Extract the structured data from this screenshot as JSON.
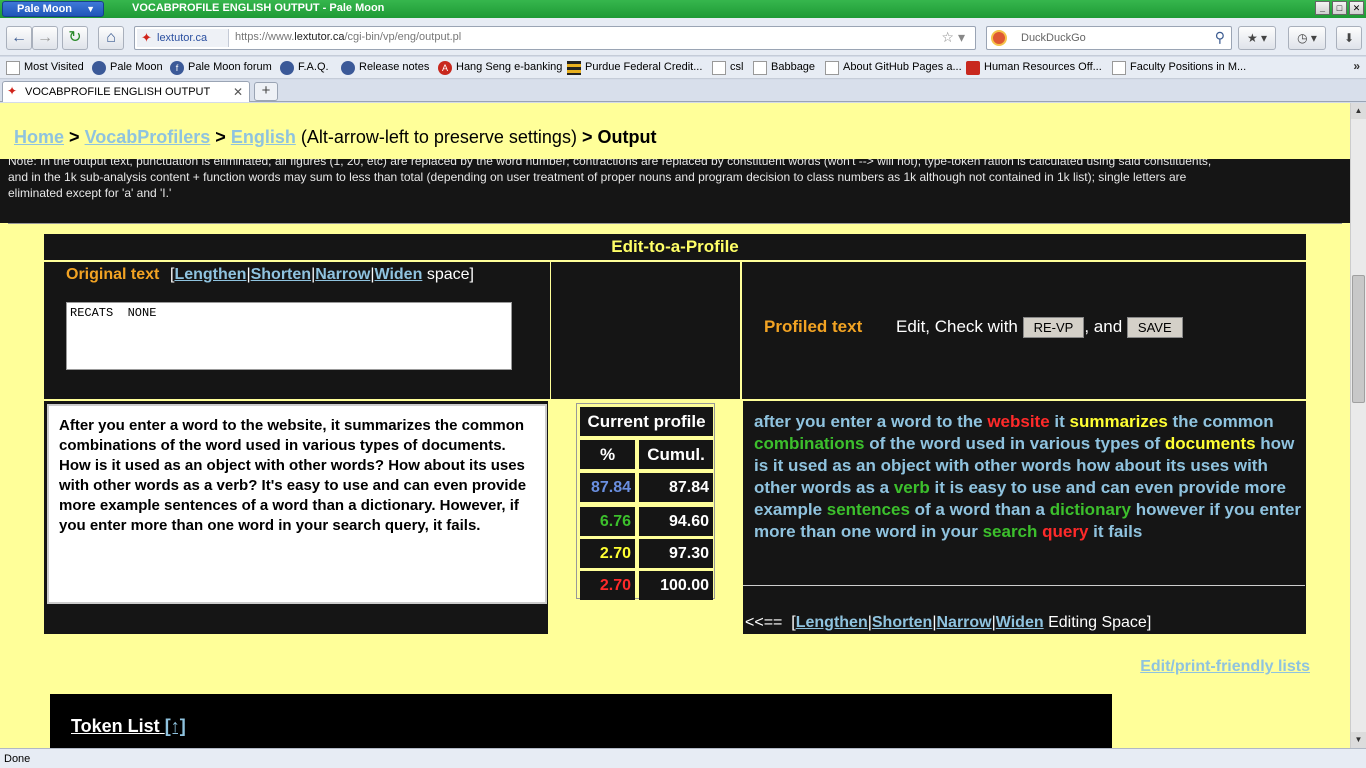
{
  "browser": {
    "app_menu": "Pale Moon",
    "window_title": "VOCABPROFILE ENGLISH OUTPUT - Pale Moon",
    "url_site": "lextutor.ca",
    "url_prefix": "https://www.",
    "url_domain": "lextutor.ca",
    "url_path": "/cgi-bin/vp/eng/output.pl",
    "search_placeholder": "DuckDuckGo",
    "tab_title": "VOCABPROFILE ENGLISH OUTPUT",
    "status": "Done"
  },
  "bookmarks": [
    {
      "label": "Most Visited",
      "icon": "star-page-icon"
    },
    {
      "label": "Pale Moon",
      "icon": "moon-icon"
    },
    {
      "label": "Pale Moon forum",
      "icon": "facebook-icon"
    },
    {
      "label": "F.A.Q.",
      "icon": "moon-icon"
    },
    {
      "label": "Release notes",
      "icon": "moon-icon"
    },
    {
      "label": "Hang Seng e-banking",
      "icon": "bank-icon"
    },
    {
      "label": "Purdue Federal Credit...",
      "icon": "stripe-icon"
    },
    {
      "label": "csl",
      "icon": "page-icon"
    },
    {
      "label": "Babbage",
      "icon": "page-icon"
    },
    {
      "label": "About GitHub Pages a...",
      "icon": "page-icon"
    },
    {
      "label": "Human Resources Off...",
      "icon": "lips-icon"
    },
    {
      "label": "Faculty Positions in M...",
      "icon": "page-icon"
    }
  ],
  "breadcrumb": {
    "home": "Home",
    "sep1": ">",
    "vocabprofilers": "VocabProfilers",
    "sep2": ">",
    "english": "English",
    "hint": "(Alt-arrow-left to preserve settings)",
    "sep3": ">",
    "output": "Output"
  },
  "note": {
    "line1": "Note: In the output text, punctuation is eliminated; all figures (1, 20, etc) are replaced by the word number; contractions are replaced by constituent words (won't --> will not); type-token ration is calculated using said constituents,",
    "line2": "and in the 1k sub-analysis content + function words may sum to less than total (depending on user treatment of proper nouns and program decision to class numbers as 1k although not contained in 1k list); single letters are",
    "line3": "eliminated except for 'a' and 'I.'"
  },
  "editor": {
    "header": "Edit-to-a-Profile",
    "original_label": "Original text",
    "lengthen": "Lengthen",
    "shorten": "Shorten",
    "narrow": "Narrow",
    "widen": "Widen",
    "space": "space",
    "recats_value": "RECATS  NONE",
    "profiled_label": "Profiled text",
    "edit_check": "Edit, Check with",
    "revp_button": "RE-VP",
    "and": ", and",
    "save_button": "SAVE",
    "input_text": "After you enter a word to the website, it summarizes the common combinations of the word used in various types of documents. How is it used as an object with other words? How about its uses with other words as a verb? It's easy to use and can even provide more example sentences of a word than a dictionary. However, if you enter more than one word in your search query, it fails.",
    "bottom_arrow": "<<==",
    "editing_space": "Editing Space"
  },
  "profile": {
    "title": "Current profile",
    "col_pct": "%",
    "col_cumul": "Cumul.",
    "rows": [
      {
        "pct": "87.84",
        "cumul": "87.84",
        "color": "#6a8fe0"
      },
      {
        "pct": "6.76",
        "cumul": "94.60",
        "color": "#3cbf2c"
      },
      {
        "pct": "2.70",
        "cumul": "97.30",
        "color": "#ffff33"
      },
      {
        "pct": "2.70",
        "cumul": "100.00",
        "color": "#ff2a2a"
      }
    ]
  },
  "profiled_words": [
    {
      "t": "after you enter a word to the ",
      "c": "c1"
    },
    {
      "t": "website",
      "c": "c4"
    },
    {
      "t": " it ",
      "c": "c1"
    },
    {
      "t": "summarizes",
      "c": "c3"
    },
    {
      "t": " the common ",
      "c": "c1"
    },
    {
      "t": "combinations",
      "c": "c2"
    },
    {
      "t": " of the word used in various types of ",
      "c": "c1"
    },
    {
      "t": "documents",
      "c": "c3"
    },
    {
      "t": " how is it used as an object with other words how about its uses with other words as a ",
      "c": "c1"
    },
    {
      "t": "verb",
      "c": "c2"
    },
    {
      "t": " it is easy to use and can even provide more example ",
      "c": "c1"
    },
    {
      "t": "sentences",
      "c": "c2"
    },
    {
      "t": " of a word than a ",
      "c": "c1"
    },
    {
      "t": "dictionary",
      "c": "c2"
    },
    {
      "t": " however if you enter more than one word in your ",
      "c": "c1"
    },
    {
      "t": "search",
      "c": "c2"
    },
    {
      "t": " ",
      "c": "c1"
    },
    {
      "t": "query",
      "c": "c4"
    },
    {
      "t": " it fails",
      "c": "c1"
    }
  ],
  "links": {
    "edit_print": "Edit/print-friendly lists",
    "token_list": "Token List",
    "token_up": "[↑]"
  }
}
